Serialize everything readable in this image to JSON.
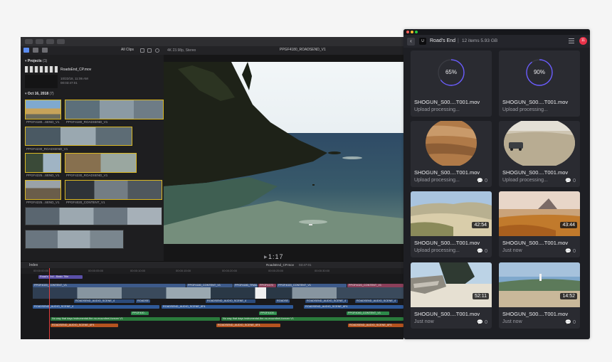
{
  "fcp": {
    "filter_label": "All Clips",
    "viewer_res": "4K 23.98p, Stereo",
    "viewer_clip": "PPGF4180_ROADSEND_V1",
    "browser": {
      "projects_header": "Projects",
      "projects_count": "(1)",
      "project_name": "RoadsEnd_CP.mov",
      "project_date": "10/22/18, 11:06 AM",
      "project_dur": "00:03:47:01",
      "event_header": "Oct 16, 2018",
      "event_count": "(7)",
      "clip_labels": [
        "PPGF4180...SEND_V1",
        "PPGF4180_ROADSEND_V1",
        "PPGF4230_ROADSEND_V1",
        "PPGF4225...SEND_V1",
        "PPGF4230_ROADSEND_V1",
        "PPGF4225...SEND_V1",
        "PPGF4020_CONTENT_V1"
      ]
    },
    "timecode": "1:17",
    "timeline": {
      "index_label": "Index",
      "project": "RoadsEnd_CP.mov",
      "duration": "03:47:01",
      "ruler": [
        "00:00:00:00",
        "00:00:05:00",
        "00:00:10:00",
        "00:00:15:00",
        "00:00:20:00",
        "00:00:25:00",
        "00:00:30:00"
      ],
      "title_clip": "Road's End - Basic Title",
      "primary_clips": [
        "PPGF4020_CONTENT_V1",
        "PPGF4180_CONTENT_V1",
        "PPGF4180_TRAIL",
        "PPGF4170",
        "PPGF4020_CONTENT_V1",
        "PPGF4020_CONTENT_V1"
      ],
      "sub_clips": [
        "ROADSEND_AUDIO_SCENE_4",
        "ROADSE...",
        "ROADSEND_AUDIO_SCENE_4",
        "ROADSE...",
        "ROADSEND_AUDIO_SCENE_4",
        "ROADSEND_AUDIO_SCENE_4"
      ],
      "audio_a": "ROADSEND_AUDIO_SCENE_4",
      "audio_b": "ROADSEND_AUDIO_SCENE_6F4",
      "audio_c": "ROADSEND_AUDIO_SCENE_6F4",
      "music_label": "No way that days instrumental-the-no-mournfeel-forever V1",
      "music_label2": "No way that days instrumental-the-no-mournfeel-forever V1",
      "sfx_label": "ROADSEND_AUDIO_SCENE_6F4",
      "small_a": "PPGF400...",
      "small_b": "PPGF4100...",
      "small_c": "PPGF4040_CONTENT_V1"
    }
  },
  "shogun": {
    "title": "Road's End",
    "separator": "|",
    "count": "12 items  5.93 GB",
    "notif_count": "11",
    "device_icon": "U",
    "back_icon": "‹",
    "cards": [
      {
        "name": "SHOGUN_S00....T001.mov",
        "status": "Upload processing...",
        "progress": "65%",
        "progress_value": 0.65,
        "comments": "",
        "duration": "",
        "thumb": "progress"
      },
      {
        "name": "SHOGUN_S00....T001.mov",
        "status": "Upload processing...",
        "progress": "90%",
        "progress_value": 0.9,
        "comments": "",
        "duration": "",
        "thumb": "progress"
      },
      {
        "name": "SHOGUN_S00....T001.mov",
        "status": "Upload processing...",
        "progress": "",
        "comments": "0",
        "duration": "",
        "thumb": "sand"
      },
      {
        "name": "SHOGUN_S00....T001.mov",
        "status": "Upload processing...",
        "progress": "",
        "comments": "0",
        "duration": "",
        "thumb": "car"
      },
      {
        "name": "SHOGUN_S00....T001.mov",
        "status": "Upload processing...",
        "progress": "",
        "comments": "0",
        "duration": "42:54",
        "thumb": "dune"
      },
      {
        "name": "SHOGUN_S00....T001.mov",
        "status": "Just now",
        "progress": "",
        "comments": "0",
        "duration": "43:44",
        "thumb": "grass"
      },
      {
        "name": "SHOGUN_S00....T001.mov",
        "status": "Just now",
        "progress": "",
        "comments": "0",
        "duration": "52:11",
        "thumb": "driftwood"
      },
      {
        "name": "SHOGUN_S00....T001.mov",
        "status": "Just now",
        "progress": "",
        "comments": "0",
        "duration": "14:52",
        "thumb": "lighthouse"
      }
    ]
  }
}
